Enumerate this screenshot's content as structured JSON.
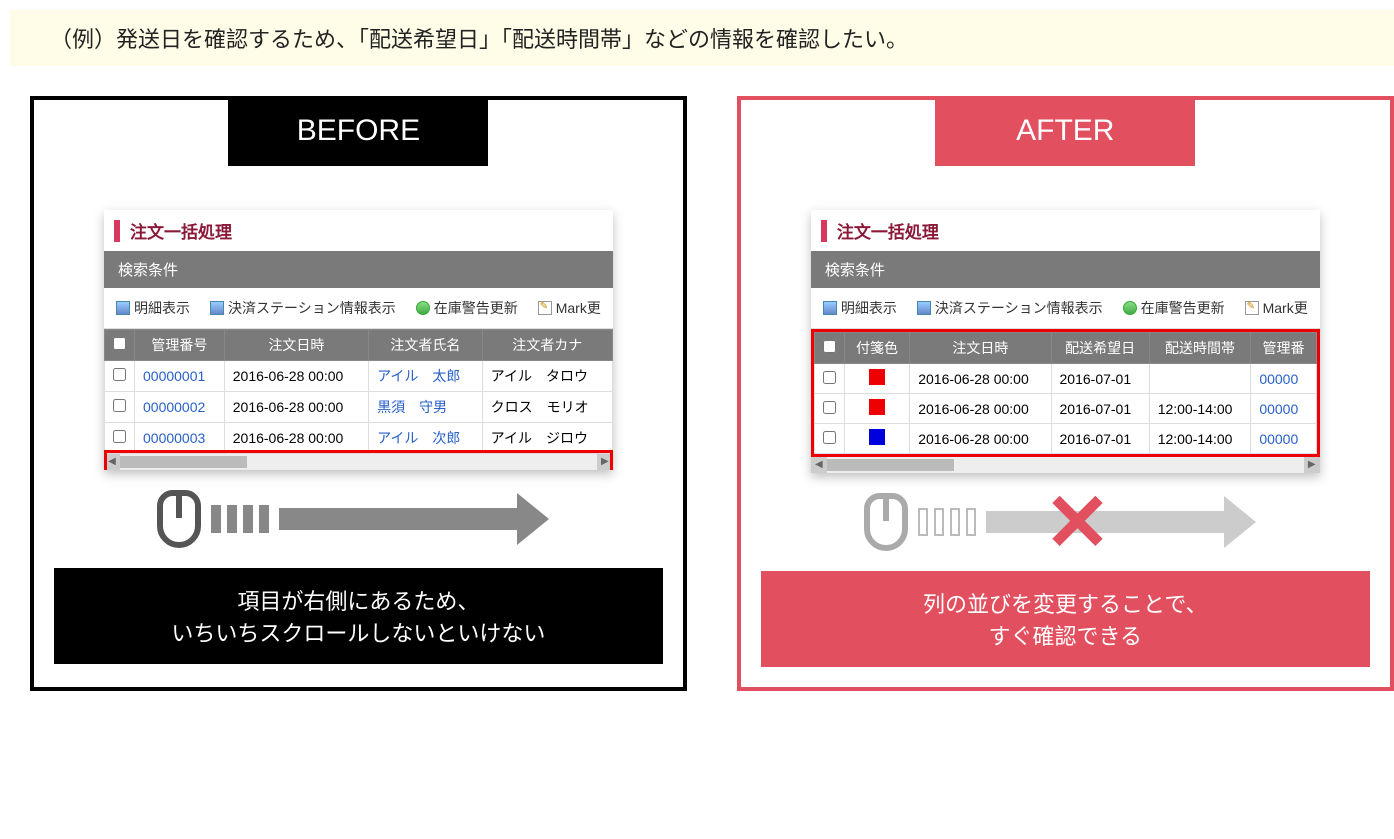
{
  "example_label": "（例）発送日を確認するため、「配送希望日」「配送時間帯」などの情報を確認したい。",
  "labels": {
    "before": "BEFORE",
    "after": "AFTER"
  },
  "common": {
    "panel_title": "注文一括処理",
    "search_conditions": "検索条件",
    "toolbar": {
      "detail": "明細表示",
      "payment": "決済ステーション情報表示",
      "stock": "在庫警告更新",
      "mark": "Mark更"
    }
  },
  "before_table": {
    "headers": {
      "mgmt_no": "管理番号",
      "order_dt": "注文日時",
      "orderer_name": "注文者氏名",
      "orderer_kana": "注文者カナ"
    },
    "rows": [
      {
        "mgmt_no": "00000001",
        "order_dt": "2016-06-28 00:00",
        "name": "アイル　太郎",
        "kana": "アイル　タロウ"
      },
      {
        "mgmt_no": "00000002",
        "order_dt": "2016-06-28 00:00",
        "name": "黒須　守男",
        "kana": "クロス　モリオ"
      },
      {
        "mgmt_no": "00000003",
        "order_dt": "2016-06-28 00:00",
        "name": "アイル　次郎",
        "kana": "アイル　ジロウ"
      }
    ]
  },
  "after_table": {
    "headers": {
      "tag_color": "付箋色",
      "order_dt": "注文日時",
      "ship_date": "配送希望日",
      "ship_slot": "配送時間帯",
      "mgmt_no": "管理番"
    },
    "rows": [
      {
        "color": "#e00",
        "order_dt": "2016-06-28 00:00",
        "ship_date": "2016-07-01",
        "ship_slot": "",
        "mgmt_no": "00000"
      },
      {
        "color": "#e00",
        "order_dt": "2016-06-28 00:00",
        "ship_date": "2016-07-01",
        "ship_slot": "12:00-14:00",
        "mgmt_no": "00000"
      },
      {
        "color": "#00d",
        "order_dt": "2016-06-28 00:00",
        "ship_date": "2016-07-01",
        "ship_slot": "12:00-14:00",
        "mgmt_no": "00000"
      }
    ]
  },
  "captions": {
    "before_l1": "項目が右側にあるため、",
    "before_l2": "いちいちスクロールしないといけない",
    "after_l1": "列の並びを変更することで、",
    "after_l2": "すぐ確認できる"
  }
}
